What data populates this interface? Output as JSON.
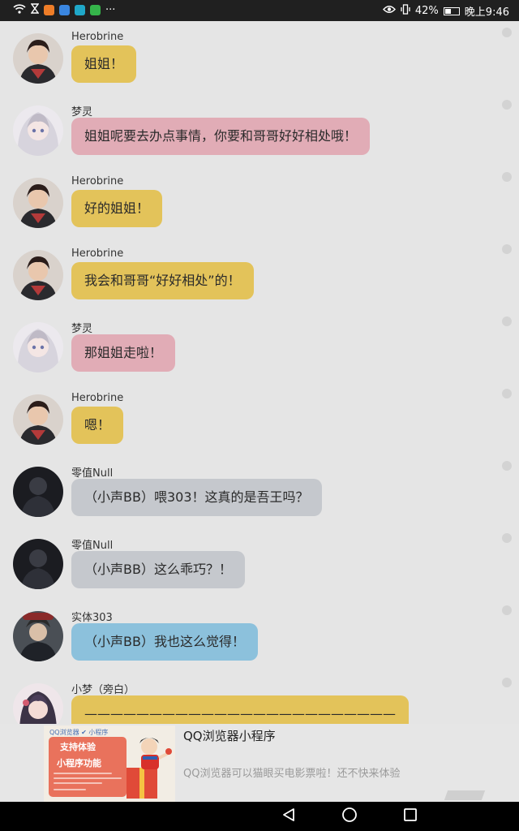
{
  "status_bar": {
    "left_icons": [
      "wifi-icon",
      "hourglass-icon",
      "app-icon-orange",
      "app-icon-blue",
      "app-icon-cyan",
      "app-icon-green",
      "more-icon"
    ],
    "more_label": "···",
    "battery_percent": "42%",
    "battery_level": 0.42,
    "time": "晚上9:46"
  },
  "messages": [
    {
      "sender": "Herobrine",
      "text": "姐姐！",
      "avatar": "herobrine",
      "bubble_color": "#e3c35a"
    },
    {
      "sender": "梦灵",
      "text": "姐姐呢要去办点事情，你要和哥哥好好相处哦！",
      "avatar": "mengling",
      "bubble_color": "#e1acb6"
    },
    {
      "sender": "Herobrine",
      "text": "好的姐姐！",
      "avatar": "herobrine",
      "bubble_color": "#e3c35a"
    },
    {
      "sender": "Herobrine",
      "text": "我会和哥哥“好好相处”的！",
      "avatar": "herobrine",
      "bubble_color": "#e3c35a"
    },
    {
      "sender": "梦灵",
      "text": "那姐姐走啦！",
      "avatar": "mengling",
      "bubble_color": "#e1acb6"
    },
    {
      "sender": "Herobrine",
      "text": "嗯！",
      "avatar": "herobrine",
      "bubble_color": "#e3c35a"
    },
    {
      "sender": "零值Null",
      "text": "（小声BB）喂303！这真的是吾王吗？",
      "avatar": "null",
      "bubble_color": "#c5c8cd"
    },
    {
      "sender": "零值Null",
      "text": "（小声BB）这么乖巧？！",
      "avatar": "null",
      "bubble_color": "#c5c8cd"
    },
    {
      "sender": "实体303",
      "text": "（小声BB）我也这么觉得！",
      "avatar": "entity303",
      "bubble_color": "#8cc1dc"
    },
    {
      "sender": "小梦（旁白）",
      "text": "————————————————————————",
      "avatar": "xiaomeng",
      "bubble_color": "#e3c35a"
    }
  ],
  "ad": {
    "title": "QQ浏览器小程序",
    "description": "QQ浏览器可以猫眼买电影票啦！还不快来体验",
    "thumb_brand": "QQ浏览器 ✔ 小程序",
    "thumb_line1": "支持体验",
    "thumb_line2": "小程序功能"
  },
  "nav_bar": {
    "back": "back-icon",
    "home": "home-icon",
    "recents": "recents-icon"
  }
}
